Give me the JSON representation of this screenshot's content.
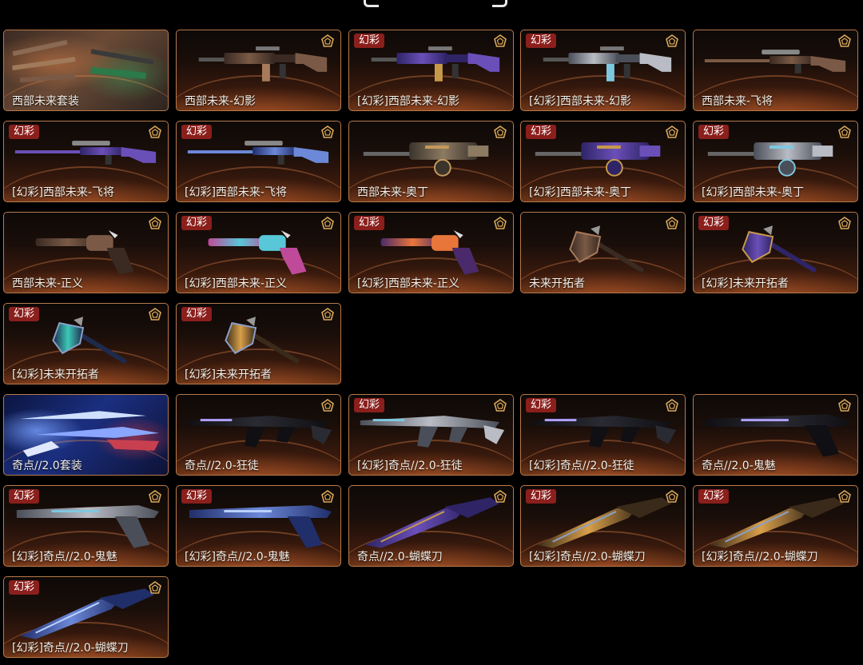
{
  "badge_label": "幻彩",
  "colors": {
    "badge_bg": "#8a1f1c",
    "card_border": "#b87a4a",
    "tier_gold": "#d9a85a",
    "text": "#f4efe8"
  },
  "cards": [
    {
      "name": "西部未来套装",
      "variant": false,
      "bundle": true,
      "weapon": "rifle-set",
      "tint": "western"
    },
    {
      "name": "西部未来-幻影",
      "variant": false,
      "weapon": "rifle",
      "tint": "western"
    },
    {
      "name": "[幻彩]西部未来-幻影",
      "variant": true,
      "weapon": "rifle",
      "tint": "purple"
    },
    {
      "name": "[幻彩]西部未来-幻影",
      "variant": true,
      "weapon": "rifle",
      "tint": "silver"
    },
    {
      "name": "西部未来-飞将",
      "variant": false,
      "weapon": "sniper",
      "tint": "western"
    },
    {
      "name": "[幻彩]西部未来-飞将",
      "variant": true,
      "weapon": "sniper",
      "tint": "purple"
    },
    {
      "name": "[幻彩]西部未来-飞将",
      "variant": true,
      "weapon": "sniper",
      "tint": "blue"
    },
    {
      "name": "西部未来-奥丁",
      "variant": false,
      "weapon": "machinegun",
      "tint": "bronze"
    },
    {
      "name": "[幻彩]西部未来-奥丁",
      "variant": true,
      "weapon": "machinegun",
      "tint": "purple"
    },
    {
      "name": "[幻彩]西部未来-奥丁",
      "variant": true,
      "weapon": "machinegun",
      "tint": "silver"
    },
    {
      "name": "西部未来-正义",
      "variant": false,
      "weapon": "revolver",
      "tint": "western"
    },
    {
      "name": "[幻彩]西部未来-正义",
      "variant": true,
      "weapon": "revolver",
      "tint": "rainbow"
    },
    {
      "name": "[幻彩]西部未来-正义",
      "variant": true,
      "weapon": "revolver",
      "tint": "fire"
    },
    {
      "name": "未来开拓者",
      "variant": false,
      "weapon": "axe",
      "tint": "western"
    },
    {
      "name": "[幻彩]未来开拓者",
      "variant": true,
      "weapon": "axe",
      "tint": "purple"
    },
    {
      "name": "[幻彩]未来开拓者",
      "variant": true,
      "weapon": "axe",
      "tint": "teal"
    },
    {
      "name": "[幻彩]未来开拓者",
      "variant": true,
      "weapon": "axe",
      "tint": "gold"
    },
    {
      "name": "奇点//2.0套装",
      "variant": false,
      "bundle": true,
      "weapon": "blade-set",
      "tint": "blue"
    },
    {
      "name": "奇点//2.0-狂徒",
      "variant": false,
      "weapon": "rifle-blade",
      "tint": "dark"
    },
    {
      "name": "[幻彩]奇点//2.0-狂徒",
      "variant": true,
      "weapon": "rifle-blade",
      "tint": "silver"
    },
    {
      "name": "[幻彩]奇点//2.0-狂徒",
      "variant": true,
      "weapon": "rifle-blade",
      "tint": "dark"
    },
    {
      "name": "奇点//2.0-鬼魅",
      "variant": false,
      "weapon": "pistol-blade",
      "tint": "dark"
    },
    {
      "name": "[幻彩]奇点//2.0-鬼魅",
      "variant": true,
      "weapon": "pistol-blade",
      "tint": "silver"
    },
    {
      "name": "[幻彩]奇点//2.0-鬼魅",
      "variant": true,
      "weapon": "pistol-blade",
      "tint": "blue"
    },
    {
      "name": "奇点//2.0-蝴蝶刀",
      "variant": false,
      "weapon": "knife",
      "tint": "purple"
    },
    {
      "name": "[幻彩]奇点//2.0-蝴蝶刀",
      "variant": true,
      "weapon": "knife",
      "tint": "gold"
    },
    {
      "name": "[幻彩]奇点//2.0-蝴蝶刀",
      "variant": true,
      "weapon": "knife",
      "tint": "gold"
    },
    {
      "name": "[幻彩]奇点//2.0-蝴蝶刀",
      "variant": true,
      "weapon": "knife",
      "tint": "blue"
    }
  ]
}
